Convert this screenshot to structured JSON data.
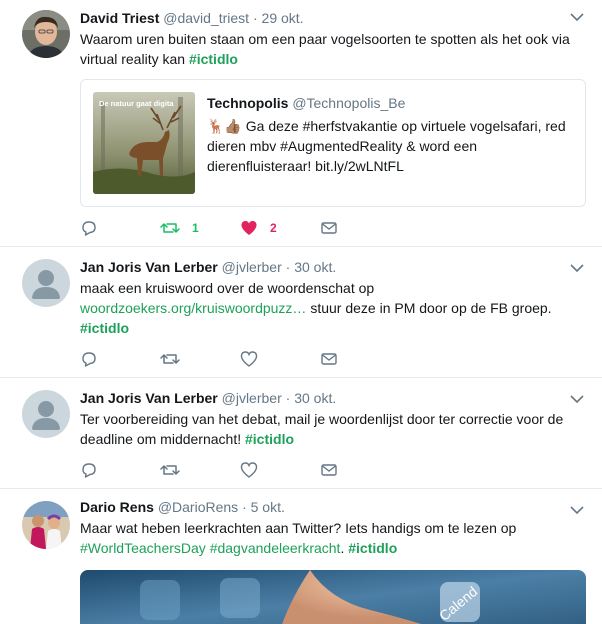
{
  "tweets": [
    {
      "name": "David Triest",
      "handle": "@david_triest",
      "dot": "·",
      "time": "29 okt.",
      "text1": "Waarom uren buiten staan om een paar vogelsoorten te spotten als het ook via virtual reality kan ",
      "hashtag": "#ictidlo",
      "quote": {
        "name": "Technopolis",
        "handle": "@Technopolis_Be",
        "emoji": "🦌👍🏽",
        "text": " Ga deze #herfstvakantie op virtuele vogelsafari, red dieren mbv #AugmentedReality & word een dierenfluisteraar! bit.ly/2wLNtFL",
        "image_caption": "De natuur gaat digita"
      },
      "retweets": "1",
      "likes": "2"
    },
    {
      "name": "Jan Joris Van Lerber",
      "handle": "@jvlerber",
      "dot": "·",
      "time": "30 okt.",
      "text1": "maak een kruiswoord over de woordenschat op",
      "link": "woordzoekers.org/kruiswoordpuzz…",
      "text2": " stuur deze in PM door op de FB groep.",
      "hashtag": "#ictidlo"
    },
    {
      "name": "Jan Joris Van Lerber",
      "handle": "@jvlerber",
      "dot": "·",
      "time": "30 okt.",
      "text1": "Ter voorbereiding van het debat, mail je woordenlijst door ter correctie voor de deadline om middernacht! ",
      "hashtag": "#ictidlo"
    },
    {
      "name": "Dario Rens",
      "handle": "@DarioRens",
      "dot": "·",
      "time": "5 okt.",
      "text1": "Maar wat heben leerkrachten aan Twitter? Iets handigs om te lezen op",
      "tag1": "#WorldTeachersDay",
      "tag2": "#dagvandeleerkracht",
      "sep": ". ",
      "hashtag": "#ictidlo",
      "media_label": "Calend"
    }
  ],
  "colors": {
    "link": "#1da15a",
    "retweet": "#17bf63",
    "like": "#e0245e",
    "secondary": "#657786",
    "border": "#e6ecf0"
  },
  "icons": [
    "reply-icon",
    "retweet-icon",
    "like-icon",
    "message-icon",
    "chevron-down-icon"
  ]
}
